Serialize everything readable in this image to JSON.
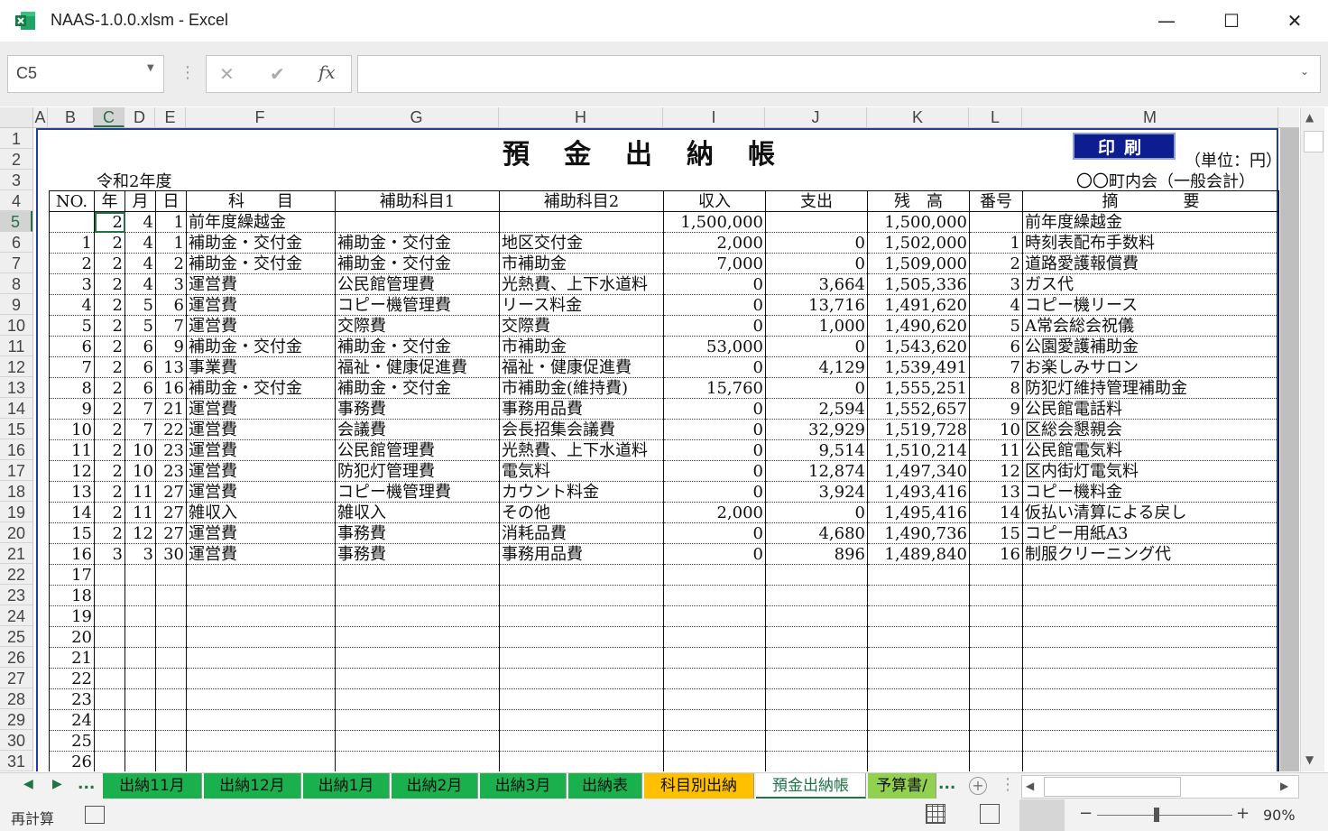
{
  "window": {
    "title": "NAAS-1.0.0.xlsm - Excel",
    "min": "—",
    "max": "☐",
    "close": "✕"
  },
  "formula": {
    "name_box": "C5",
    "cancel": "✕",
    "enter": "✔",
    "fx": "fx",
    "value": ""
  },
  "columns": [
    "A",
    "B",
    "C",
    "D",
    "E",
    "F",
    "G",
    "H",
    "I",
    "J",
    "K",
    "L",
    "M"
  ],
  "rows": [
    "1",
    "2",
    "3",
    "4",
    "5",
    "6",
    "7",
    "8",
    "9",
    "10",
    "11",
    "12",
    "13",
    "14",
    "15",
    "16",
    "17",
    "18",
    "19",
    "20",
    "21",
    "22",
    "23",
    "24",
    "25",
    "26",
    "27",
    "28",
    "29",
    "30",
    "31"
  ],
  "ledger": {
    "title": "預金出納帳",
    "print_button": "印刷",
    "unit": "（単位：円）",
    "year": "令和2年度",
    "org": "〇〇町内会（一般会計）",
    "headers": [
      "NO.",
      "年",
      "月",
      "日",
      "科　　目",
      "補助科目1",
      "補助科目2",
      "収入",
      "支出",
      "残　高",
      "番号",
      "摘　　　　要"
    ],
    "rows": [
      [
        "",
        "2",
        "4",
        "1",
        "前年度繰越金",
        "",
        "",
        "1,500,000",
        "",
        "1,500,000",
        "",
        "前年度繰越金"
      ],
      [
        "1",
        "2",
        "4",
        "1",
        "補助金・交付金",
        "補助金・交付金",
        "地区交付金",
        "2,000",
        "0",
        "1,502,000",
        "1",
        "時刻表配布手数料"
      ],
      [
        "2",
        "2",
        "4",
        "2",
        "補助金・交付金",
        "補助金・交付金",
        "市補助金",
        "7,000",
        "0",
        "1,509,000",
        "2",
        "道路愛護報償費"
      ],
      [
        "3",
        "2",
        "4",
        "3",
        "運営費",
        "公民館管理費",
        "光熱費、上下水道料",
        "0",
        "3,664",
        "1,505,336",
        "3",
        "ガス代"
      ],
      [
        "4",
        "2",
        "5",
        "6",
        "運営費",
        "コピー機管理費",
        "リース料金",
        "0",
        "13,716",
        "1,491,620",
        "4",
        "コピー機リース"
      ],
      [
        "5",
        "2",
        "5",
        "7",
        "運営費",
        "交際費",
        "交際費",
        "0",
        "1,000",
        "1,490,620",
        "5",
        "A常会総会祝儀"
      ],
      [
        "6",
        "2",
        "6",
        "9",
        "補助金・交付金",
        "補助金・交付金",
        "市補助金",
        "53,000",
        "0",
        "1,543,620",
        "6",
        "公園愛護補助金"
      ],
      [
        "7",
        "2",
        "6",
        "13",
        "事業費",
        "福祉・健康促進費",
        "福祉・健康促進費",
        "0",
        "4,129",
        "1,539,491",
        "7",
        "お楽しみサロン"
      ],
      [
        "8",
        "2",
        "6",
        "16",
        "補助金・交付金",
        "補助金・交付金",
        "市補助金(維持費)",
        "15,760",
        "0",
        "1,555,251",
        "8",
        "防犯灯維持管理補助金"
      ],
      [
        "9",
        "2",
        "7",
        "21",
        "運営費",
        "事務費",
        "事務用品費",
        "0",
        "2,594",
        "1,552,657",
        "9",
        "公民館電話料"
      ],
      [
        "10",
        "2",
        "7",
        "22",
        "運営費",
        "会議費",
        "会長招集会議費",
        "0",
        "32,929",
        "1,519,728",
        "10",
        "区総会懇親会"
      ],
      [
        "11",
        "2",
        "10",
        "23",
        "運営費",
        "公民館管理費",
        "光熱費、上下水道料",
        "0",
        "9,514",
        "1,510,214",
        "11",
        "公民館電気料"
      ],
      [
        "12",
        "2",
        "10",
        "23",
        "運営費",
        "防犯灯管理費",
        "電気料",
        "0",
        "12,874",
        "1,497,340",
        "12",
        "区内街灯電気料"
      ],
      [
        "13",
        "2",
        "11",
        "27",
        "運営費",
        "コピー機管理費",
        "カウント料金",
        "0",
        "3,924",
        "1,493,416",
        "13",
        "コピー機料金"
      ],
      [
        "14",
        "2",
        "11",
        "27",
        "雑収入",
        "雑収入",
        "その他",
        "2,000",
        "0",
        "1,495,416",
        "14",
        "仮払い清算による戻し"
      ],
      [
        "15",
        "2",
        "12",
        "27",
        "運営費",
        "事務費",
        "消耗品費",
        "0",
        "4,680",
        "1,490,736",
        "15",
        "コピー用紙A3"
      ],
      [
        "16",
        "3",
        "3",
        "30",
        "運営費",
        "事務費",
        "事務用品費",
        "0",
        "896",
        "1,489,840",
        "16",
        "制服クリーニング代"
      ],
      [
        "17",
        "",
        "",
        "",
        "",
        "",
        "",
        "",
        "",
        "",
        "",
        ""
      ],
      [
        "18",
        "",
        "",
        "",
        "",
        "",
        "",
        "",
        "",
        "",
        "",
        ""
      ],
      [
        "19",
        "",
        "",
        "",
        "",
        "",
        "",
        "",
        "",
        "",
        "",
        ""
      ],
      [
        "20",
        "",
        "",
        "",
        "",
        "",
        "",
        "",
        "",
        "",
        "",
        ""
      ],
      [
        "21",
        "",
        "",
        "",
        "",
        "",
        "",
        "",
        "",
        "",
        "",
        ""
      ],
      [
        "22",
        "",
        "",
        "",
        "",
        "",
        "",
        "",
        "",
        "",
        "",
        ""
      ],
      [
        "23",
        "",
        "",
        "",
        "",
        "",
        "",
        "",
        "",
        "",
        "",
        ""
      ],
      [
        "24",
        "",
        "",
        "",
        "",
        "",
        "",
        "",
        "",
        "",
        "",
        ""
      ],
      [
        "25",
        "",
        "",
        "",
        "",
        "",
        "",
        "",
        "",
        "",
        "",
        ""
      ],
      [
        "26",
        "",
        "",
        "",
        "",
        "",
        "",
        "",
        "",
        "",
        "",
        ""
      ]
    ]
  },
  "tabs": [
    "出納11月",
    "出納12月",
    "出納1月",
    "出納2月",
    "出納3月",
    "出納表",
    "科目別出納",
    "預金出納帳",
    "予算書/"
  ],
  "tab_more": "...",
  "status": {
    "left": "再計算",
    "zoom": "90%"
  }
}
